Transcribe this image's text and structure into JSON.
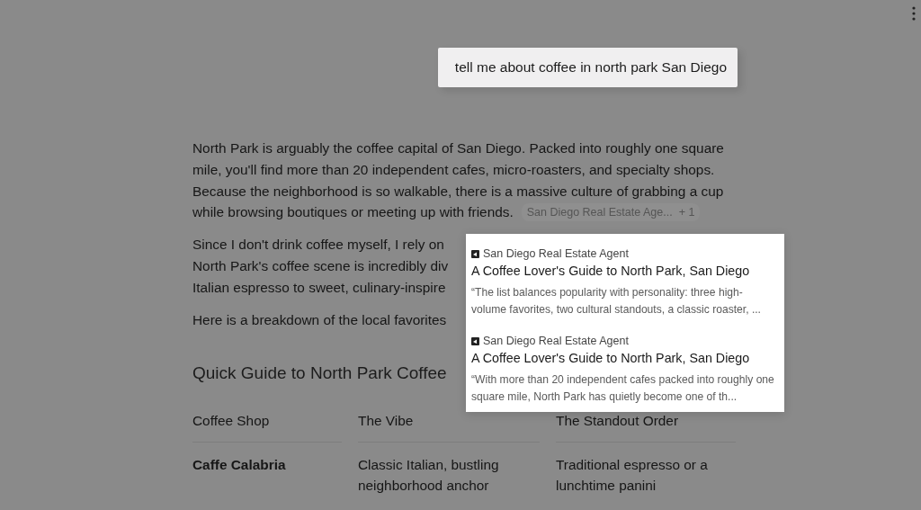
{
  "query": "tell me about coffee in north park San Diego",
  "paragraph_1": {
    "lines": [
      "North Park is arguably the coffee capital of San Diego. Packed into roughly one square",
      "mile, you'll find more than 20 independent cafes, micro-roasters, and specialty shops.",
      "Because the neighborhood is so walkable, there is a massive culture of grabbing a cup",
      "while browsing boutiques or meeting up with friends."
    ],
    "citation_chip": {
      "source": "San Diego Real Estate Age...",
      "extra": "+ 1"
    }
  },
  "paragraph_2": {
    "lines": [
      "Since I don't drink coffee myself, I rely on",
      "North Park's coffee scene is incredibly div",
      "Italian espresso to sweet, culinary-inspire"
    ]
  },
  "paragraph_3": "Here is a breakdown of the local favorites",
  "heading": "Quick Guide to North Park Coffee",
  "table": {
    "columns": [
      "Coffee Shop",
      "The Vibe",
      "The Standout Order"
    ],
    "rows": [
      [
        "Caffe Calabria",
        "Classic Italian, bustling neighborhood anchor",
        "Traditional espresso or a lunchtime panini"
      ]
    ]
  },
  "citation_popup": {
    "sources": [
      {
        "site": "San Diego Real Estate Agent",
        "title": "A Coffee Lover's Guide to North Park, San Diego",
        "snippet": "“The list balances popularity with personality: three high-volume favorites, two cultural standouts, a classic roaster, ..."
      },
      {
        "site": "San Diego Real Estate Agent",
        "title": "A Coffee Lover's Guide to North Park, San Diego",
        "snippet": "“With more than 20 independent cafes packed into roughly one square mile, North Park has quietly become one of th..."
      }
    ]
  }
}
